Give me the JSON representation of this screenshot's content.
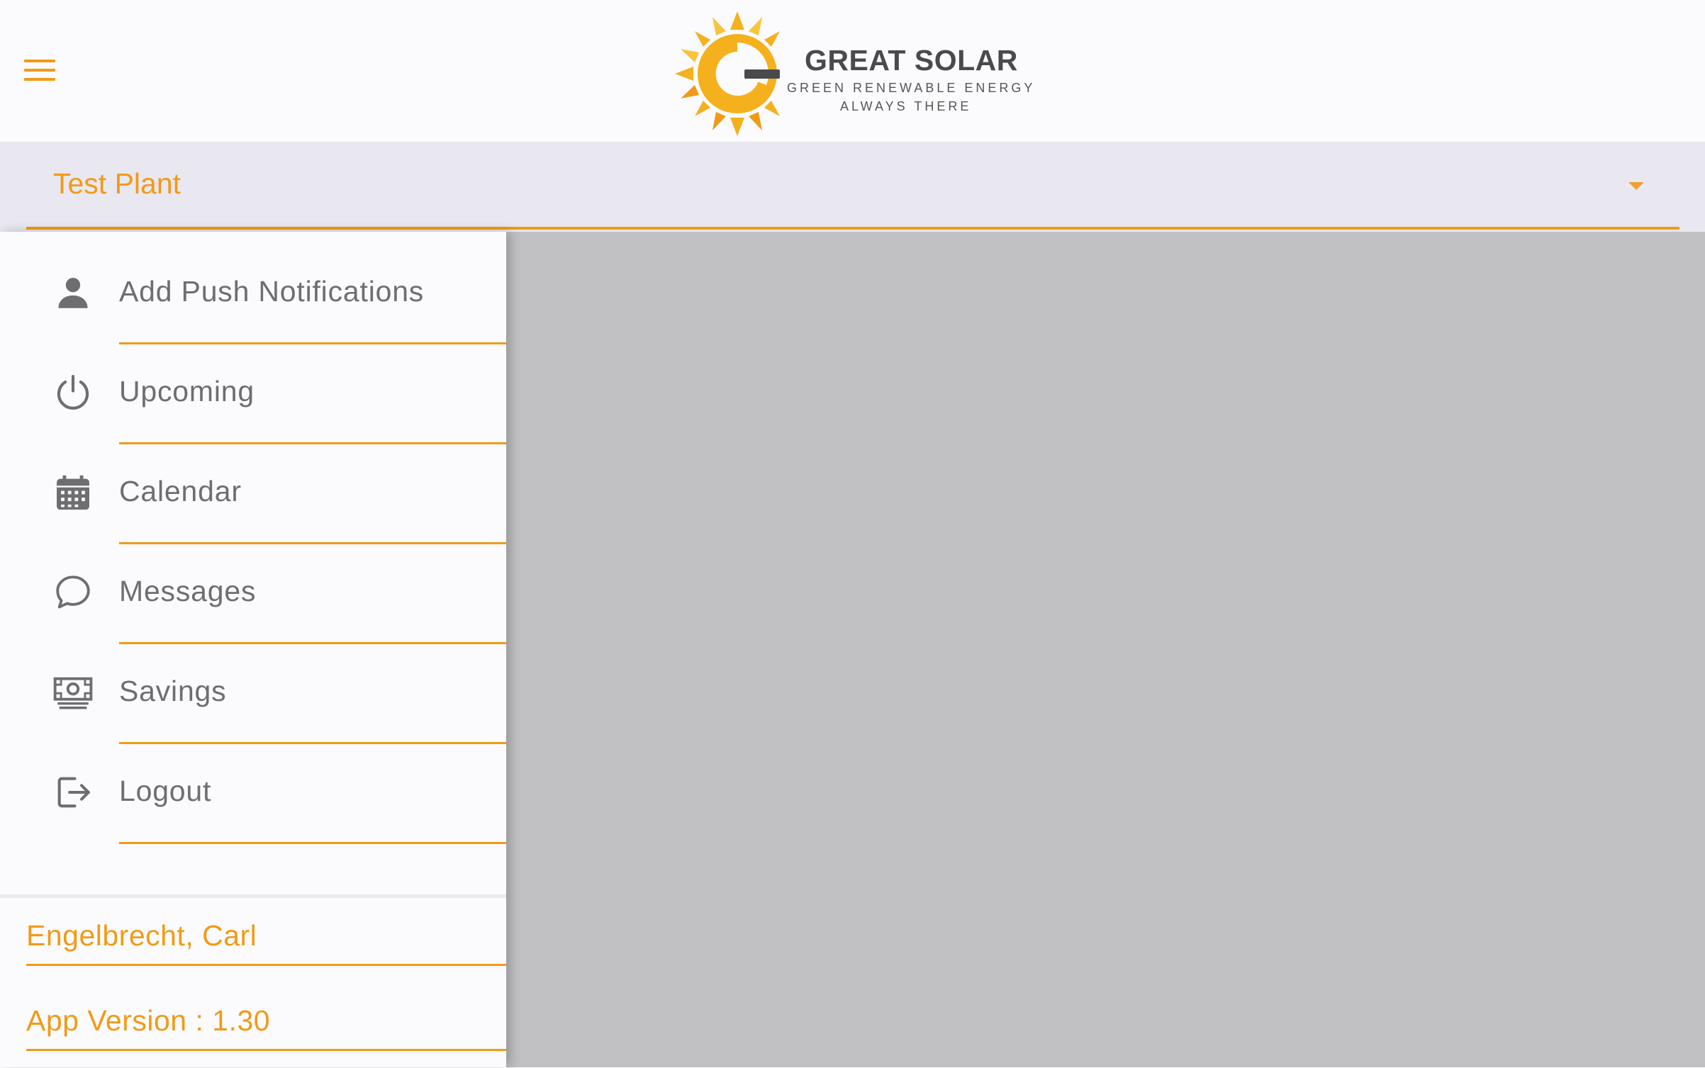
{
  "colors": {
    "accent": "#f29a17",
    "menu_text": "#6e6e70",
    "icon": "#6e6e70",
    "overlay": "#c1c0c3",
    "selector_bg": "#e9e8f0"
  },
  "header": {
    "menu_icon": "hamburger-menu-icon",
    "logo": {
      "title": "GREAT SOLAR",
      "tagline_line1": "GREEN RENEWABLE ENERGY",
      "tagline_line2": "ALWAYS THERE",
      "icon": "sun-logo-icon"
    }
  },
  "plant_selector": {
    "selected": "Test Plant",
    "icon": "caret-down-icon"
  },
  "drawer": {
    "items": [
      {
        "label": "Add Push Notifications",
        "icon": "person-icon"
      },
      {
        "label": "Upcoming",
        "icon": "power-icon"
      },
      {
        "label": "Calendar",
        "icon": "calendar-icon"
      },
      {
        "label": "Messages",
        "icon": "chat-bubble-icon"
      },
      {
        "label": "Savings",
        "icon": "money-icon"
      },
      {
        "label": "Logout",
        "icon": "logout-icon"
      }
    ],
    "footer": {
      "user_name": "Engelbrecht, Carl",
      "app_version": "App Version : 1.30"
    }
  }
}
